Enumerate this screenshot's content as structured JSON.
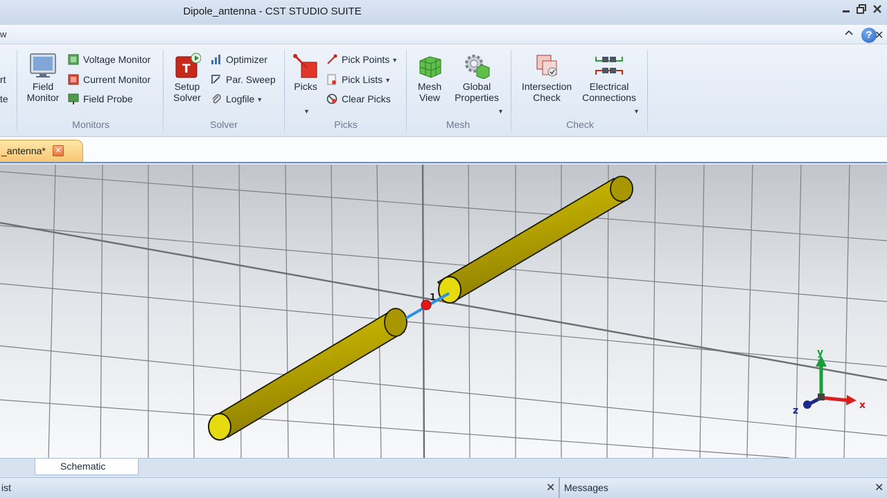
{
  "window": {
    "title": "Dipole_antenna - CST STUDIO SUITE"
  },
  "menu": {
    "visible_fragment": "w"
  },
  "ribbon": {
    "left_fragments": [
      "rt",
      "te"
    ],
    "monitors": {
      "field_monitor": "Field\nMonitor",
      "voltage_monitor": "Voltage Monitor",
      "current_monitor": "Current Monitor",
      "field_probe": "Field Probe",
      "group_label": "Monitors"
    },
    "solver": {
      "setup_solver": "Setup\nSolver",
      "optimizer": "Optimizer",
      "par_sweep": "Par. Sweep",
      "logfile": "Logfile",
      "group_label": "Solver"
    },
    "picks": {
      "picks": "Picks",
      "pick_points": "Pick Points",
      "pick_lists": "Pick Lists",
      "clear_picks": "Clear Picks",
      "group_label": "Picks"
    },
    "mesh": {
      "mesh_view": "Mesh\nView",
      "global_properties": "Global\nProperties",
      "group_label": "Mesh"
    },
    "check": {
      "intersection_check": "Intersection\nCheck",
      "electrical_connections": "Electrical\nConnections",
      "group_label": "Check"
    }
  },
  "document_tab": {
    "label": "_antenna*"
  },
  "viewport": {
    "port_label": "1",
    "axes": {
      "x": "x",
      "y": "y",
      "z": "z"
    },
    "colors": {
      "dipole": "#b9a800",
      "port_line": "#2f8fe0",
      "port_marker": "#e01818",
      "x_axis": "#d42020",
      "y_axis": "#18a038",
      "z_axis": "#1c2a8a"
    }
  },
  "bottom_tabs": {
    "schematic": "Schematic"
  },
  "panels": {
    "left_fragment": "ist",
    "messages": "Messages"
  }
}
